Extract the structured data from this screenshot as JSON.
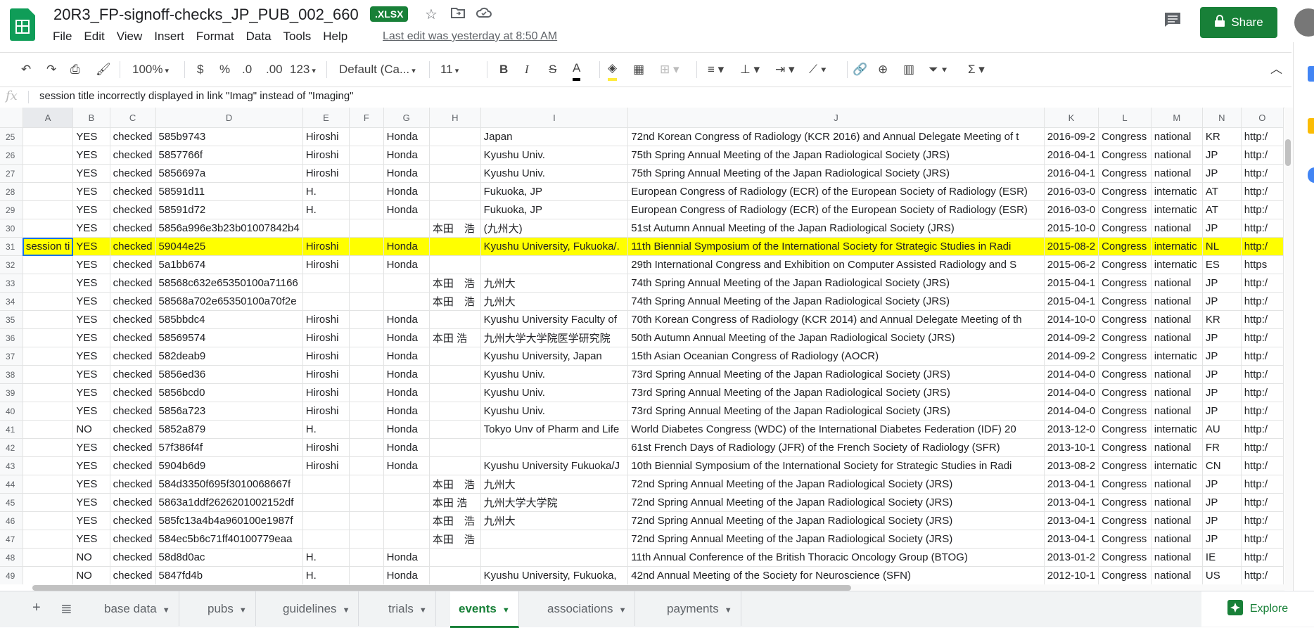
{
  "app": {
    "title": "20R3_FP-signoff-checks_JP_PUB_002_660",
    "badge": ".XLSX",
    "last_edit": "Last edit was yesterday at 8:50 AM",
    "share_label": "Share",
    "menu": [
      "File",
      "Edit",
      "View",
      "Insert",
      "Format",
      "Data",
      "Tools",
      "Help"
    ]
  },
  "toolbar": {
    "zoom": "100%",
    "currency": "$",
    "percent": "%",
    "dec_decrease": ".0",
    "dec_increase": ".00",
    "format_more": "123",
    "font": "Default (Ca...",
    "font_size": "11"
  },
  "formula_bar": {
    "fx": "fx",
    "content": "session title incorrectly displayed in link \"Imag\" instead of \"Imaging\""
  },
  "columns": [
    "A",
    "B",
    "C",
    "D",
    "E",
    "F",
    "G",
    "H",
    "I",
    "J",
    "K",
    "L",
    "M",
    "N",
    "O"
  ],
  "rows": [
    {
      "n": "25",
      "c": [
        "",
        "YES",
        "checked",
        "585b9743",
        "Hiroshi",
        "",
        "Honda",
        "",
        "Japan",
        "72nd Korean Congress of Radiology (KCR 2016) and Annual Delegate Meeting of t",
        "2016-09-2",
        "Congress",
        "national",
        "KR",
        "http:/"
      ]
    },
    {
      "n": "26",
      "c": [
        "",
        "YES",
        "checked",
        "5857766f",
        "Hiroshi",
        "",
        "Honda",
        "",
        "Kyushu Univ.",
        "75th Spring Annual Meeting of the Japan Radiological Society (JRS)",
        "2016-04-1",
        "Congress",
        "national",
        "JP",
        "http:/"
      ]
    },
    {
      "n": "27",
      "c": [
        "",
        "YES",
        "checked",
        "5856697a",
        "Hiroshi",
        "",
        "Honda",
        "",
        "Kyushu Univ.",
        "75th Spring Annual Meeting of the Japan Radiological Society (JRS)",
        "2016-04-1",
        "Congress",
        "national",
        "JP",
        "http:/"
      ]
    },
    {
      "n": "28",
      "c": [
        "",
        "YES",
        "checked",
        "58591d11",
        "H.",
        "",
        "Honda",
        "",
        "Fukuoka, JP",
        "European Congress of Radiology (ECR) of the European Society of Radiology (ESR)",
        "2016-03-0",
        "Congress",
        "internatic",
        "AT",
        "http:/"
      ]
    },
    {
      "n": "29",
      "c": [
        "",
        "YES",
        "checked",
        "58591d72",
        "H.",
        "",
        "Honda",
        "",
        "Fukuoka, JP",
        "European Congress of Radiology (ECR) of the European Society of Radiology (ESR)",
        "2016-03-0",
        "Congress",
        "internatic",
        "AT",
        "http:/"
      ]
    },
    {
      "n": "30",
      "c": [
        "",
        "YES",
        "checked",
        "5856a996e3b23b01007842b4",
        "",
        "",
        "",
        "本田　浩",
        "(九州大)",
        "51st Autumn Annual Meeting of the Japan Radiological Society (JRS)",
        "2015-10-0",
        "Congress",
        "national",
        "JP",
        "http:/"
      ]
    },
    {
      "n": "31",
      "c": [
        "session ti",
        "YES",
        "checked",
        "59044e25",
        "Hiroshi",
        "",
        "Honda",
        "",
        "Kyushu University, Fukuoka/.",
        "11th Biennial Symposium of the International Society for Strategic Studies in Radi",
        "2015-08-2",
        "Congress",
        "internatic",
        "NL",
        "http:/"
      ]
    },
    {
      "n": "32",
      "c": [
        "",
        "YES",
        "checked",
        "5a1bb674",
        "Hiroshi",
        "",
        "Honda",
        "",
        "",
        "29th International Congress and Exhibition on Computer Assisted Radiology and S",
        "2015-06-2",
        "Congress",
        "internatic",
        "ES",
        "https"
      ]
    },
    {
      "n": "33",
      "c": [
        "",
        "YES",
        "checked",
        "58568c632e65350100a71166",
        "",
        "",
        "",
        "本田　浩",
        "九州大",
        "74th Spring Annual Meeting of the Japan Radiological Society (JRS)",
        "2015-04-1",
        "Congress",
        "national",
        "JP",
        "http:/"
      ]
    },
    {
      "n": "34",
      "c": [
        "",
        "YES",
        "checked",
        "58568a702e65350100a70f2e",
        "",
        "",
        "",
        "本田　浩",
        "九州大",
        "74th Spring Annual Meeting of the Japan Radiological Society (JRS)",
        "2015-04-1",
        "Congress",
        "national",
        "JP",
        "http:/"
      ]
    },
    {
      "n": "35",
      "c": [
        "",
        "YES",
        "checked",
        "585bbdc4",
        "Hiroshi",
        "",
        "Honda",
        "",
        "Kyushu University Faculty of",
        "70th Korean Congress of Radiology (KCR 2014) and Annual Delegate Meeting of th",
        "2014-10-0",
        "Congress",
        "national",
        "KR",
        "http:/"
      ]
    },
    {
      "n": "36",
      "c": [
        "",
        "YES",
        "checked",
        "58569574",
        "Hiroshi",
        "",
        "Honda",
        "本田 浩",
        "九州大学大学院医学研究院",
        "50th Autumn Annual Meeting of the Japan Radiological Society (JRS)",
        "2014-09-2",
        "Congress",
        "national",
        "JP",
        "http:/"
      ]
    },
    {
      "n": "37",
      "c": [
        "",
        "YES",
        "checked",
        "582deab9",
        "Hiroshi",
        "",
        "Honda",
        "",
        "Kyushu University, Japan",
        "15th Asian Oceanian Congress of Radiology (AOCR)",
        "2014-09-2",
        "Congress",
        "internatic",
        "JP",
        "http:/"
      ]
    },
    {
      "n": "38",
      "c": [
        "",
        "YES",
        "checked",
        "5856ed36",
        "Hiroshi",
        "",
        "Honda",
        "",
        "Kyushu Univ.",
        "73rd Spring Annual Meeting of the Japan Radiological Society (JRS)",
        "2014-04-0",
        "Congress",
        "national",
        "JP",
        "http:/"
      ]
    },
    {
      "n": "39",
      "c": [
        "",
        "YES",
        "checked",
        "5856bcd0",
        "Hiroshi",
        "",
        "Honda",
        "",
        "Kyushu Univ.",
        "73rd Spring Annual Meeting of the Japan Radiological Society (JRS)",
        "2014-04-0",
        "Congress",
        "national",
        "JP",
        "http:/"
      ]
    },
    {
      "n": "40",
      "c": [
        "",
        "YES",
        "checked",
        "5856a723",
        "Hiroshi",
        "",
        "Honda",
        "",
        "Kyushu Univ.",
        "73rd Spring Annual Meeting of the Japan Radiological Society (JRS)",
        "2014-04-0",
        "Congress",
        "national",
        "JP",
        "http:/"
      ]
    },
    {
      "n": "41",
      "c": [
        "",
        "NO",
        "checked",
        "5852a879",
        "H.",
        "",
        "Honda",
        "",
        "Tokyo Unv of Pharm and Life",
        "World Diabetes Congress (WDC) of the International Diabetes Federation (IDF) 20",
        "2013-12-0",
        "Congress",
        "internatic",
        "AU",
        "http:/"
      ]
    },
    {
      "n": "42",
      "c": [
        "",
        "YES",
        "checked",
        "57f386f4f",
        "Hiroshi",
        "",
        "Honda",
        "",
        "",
        "61st French Days of Radiology (JFR) of the French Society of Radiology (SFR)",
        "2013-10-1",
        "Congress",
        "national",
        "FR",
        "http:/"
      ]
    },
    {
      "n": "43",
      "c": [
        "",
        "YES",
        "checked",
        "5904b6d9",
        "Hiroshi",
        "",
        "Honda",
        "",
        "Kyushu University Fukuoka/J",
        "10th Biennial Symposium of the International Society for Strategic Studies in Radi",
        "2013-08-2",
        "Congress",
        "internatic",
        "CN",
        "http:/"
      ]
    },
    {
      "n": "44",
      "c": [
        "",
        "YES",
        "checked",
        "584d3350f695f3010068667f",
        "",
        "",
        "",
        "本田　浩",
        "九州大",
        "72nd Spring Annual Meeting of the Japan Radiological Society (JRS)",
        "2013-04-1",
        "Congress",
        "national",
        "JP",
        "http:/"
      ]
    },
    {
      "n": "45",
      "c": [
        "",
        "YES",
        "checked",
        "5863a1ddf2626201002152df",
        "",
        "",
        "",
        "本田 浩",
        "九州大学大学院",
        "72nd Spring Annual Meeting of the Japan Radiological Society (JRS)",
        "2013-04-1",
        "Congress",
        "national",
        "JP",
        "http:/"
      ]
    },
    {
      "n": "46",
      "c": [
        "",
        "YES",
        "checked",
        "585fc13a4b4a960100e1987f",
        "",
        "",
        "",
        "本田　浩",
        "九州大",
        "72nd Spring Annual Meeting of the Japan Radiological Society (JRS)",
        "2013-04-1",
        "Congress",
        "national",
        "JP",
        "http:/"
      ]
    },
    {
      "n": "47",
      "c": [
        "",
        "YES",
        "checked",
        "584ec5b6c71ff40100779eaa",
        "",
        "",
        "",
        "本田　浩",
        "",
        "72nd Spring Annual Meeting of the Japan Radiological Society (JRS)",
        "2013-04-1",
        "Congress",
        "national",
        "JP",
        "http:/"
      ]
    },
    {
      "n": "48",
      "c": [
        "",
        "NO",
        "checked",
        "58d8d0ac",
        "H.",
        "",
        "Honda",
        "",
        "",
        "11th Annual Conference of the British Thoracic Oncology Group (BTOG)",
        "2013-01-2",
        "Congress",
        "national",
        "IE",
        "http:/"
      ]
    },
    {
      "n": "49",
      "c": [
        "",
        "NO",
        "checked",
        "5847fd4b",
        "H.",
        "",
        "Honda",
        "",
        "Kyushu University, Fukuoka,",
        "42nd Annual Meeting of the Society for Neuroscience (SFN)",
        "2012-10-1",
        "Congress",
        "national",
        "US",
        "http:/"
      ]
    }
  ],
  "highlight_color": "#ffff00",
  "sheets": [
    "base data",
    "pubs",
    "guidelines",
    "trials",
    "events",
    "associations",
    "payments"
  ],
  "active_sheet": "events",
  "explore_label": "Explore",
  "accent": "#188038"
}
